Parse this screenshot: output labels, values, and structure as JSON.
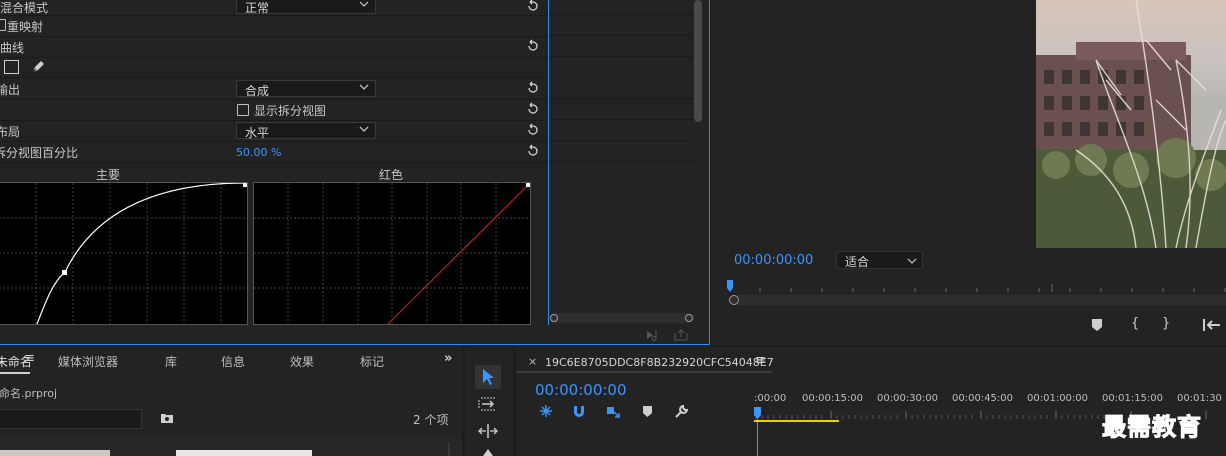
{
  "effects": {
    "rows": [
      {
        "label": "混合模式",
        "value": "正常",
        "type": "dropdown"
      },
      {
        "label": "重映射",
        "type": "checkbox"
      },
      {
        "label": "曲线",
        "type": "header"
      },
      {
        "label": "",
        "type": "tools"
      },
      {
        "label": "输出",
        "value": "合成",
        "type": "dropdown"
      },
      {
        "label": "显示拆分视图",
        "type": "checkbox-option"
      },
      {
        "label": "布局",
        "value": "水平",
        "type": "dropdown"
      },
      {
        "label": "拆分视图百分比",
        "value": "50.00 %",
        "type": "value"
      }
    ],
    "curve_main_title": "主要",
    "curve_red_title": "红色"
  },
  "monitor": {
    "timecode": "00:00:00:00",
    "fit": "适合",
    "accent": "#2d8ceb"
  },
  "project": {
    "tabs": [
      "项目: 未命名",
      "媒体浏览器",
      "库",
      "信息",
      "效果",
      "标记"
    ],
    "file": "未命名.prproj",
    "count": "2 个项"
  },
  "timeline": {
    "sequence": "19C6E8705DDC8F8B232920CFC54048E7",
    "timecode": "00:00:00:00",
    "ruler": [
      ":00:00",
      "00:00:15:00",
      "00:00:30:00",
      "00:00:45:00",
      "00:01:00:00",
      "00:01:15:00",
      "00:01:30"
    ]
  },
  "watermark": "最需教育"
}
